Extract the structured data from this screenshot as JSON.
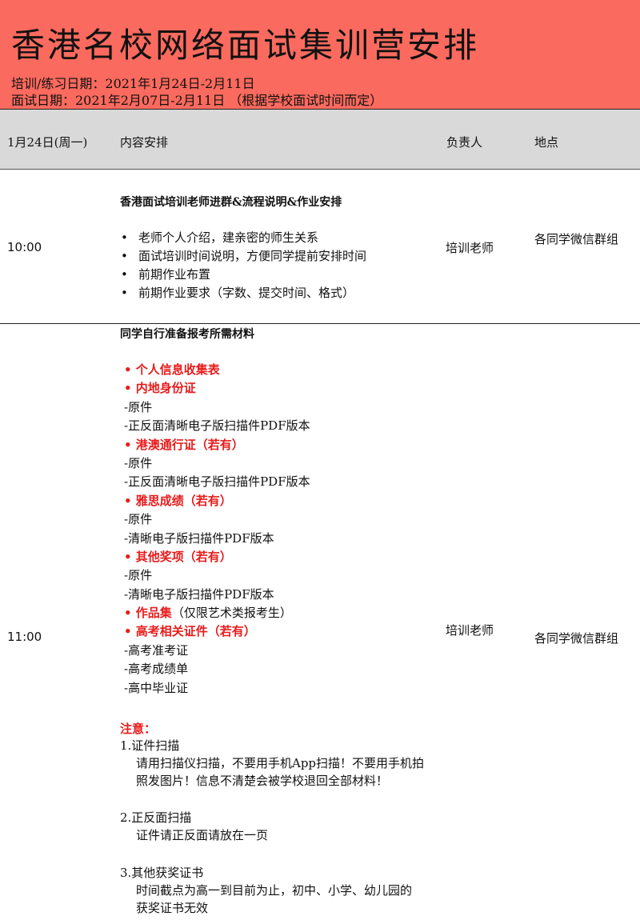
{
  "header": {
    "title": "香港名校网络面试集训营安排",
    "training_dates": "培训/练习日期：2021年1月24日-2月11日",
    "interview_dates": "面试日期：2021年2月07日-2月11日  （根据学校面试时间而定）"
  },
  "columns": {
    "date": "1月24日(周一)",
    "content": "内容安排",
    "owner": "负责人",
    "location": "地点"
  },
  "row1": {
    "time": "10:00",
    "heading": "香港面试培训老师进群&流程说明&作业安排",
    "bullets": [
      "老师个人介绍，建亲密的师生关系",
      "面试培训时间说明，方便同学提前安排时间",
      "前期作业布置",
      "前期作业要求（字数、提交时间、格式）"
    ],
    "owner": "培训老师",
    "location": "各同学微信群组"
  },
  "row2": {
    "time": "11:00",
    "heading": "同学自行准备报考所需材料",
    "owner": "培训老师",
    "location": "各同学微信群组",
    "materials": {
      "m1": "• 个人信息收集表",
      "m2": "• 内地身份证",
      "m2a": "-原件",
      "m2b": "-正反面清晰电子版扫描件PDF版本",
      "m3": "• 港澳通行证（若有）",
      "m3a": "-原件",
      "m3b": "-正反面清晰电子版扫描件PDF版本",
      "m4": "• 雅思成绩（若有）",
      "m4a": "-原件",
      "m4b": "-清晰电子版扫描件PDF版本",
      "m5": "• 其他奖项（若有）",
      "m5a": "-原件",
      "m5b": "-清晰电子版扫描件PDF版本",
      "m6": "• 作品集",
      "m6_note": "（仅限艺术类报考生）",
      "m7": "• 高考相关证件（若有）",
      "m7a": "-高考准考证",
      "m7b": "-高考成绩单",
      "m7c": "-高中毕业证"
    },
    "notes": {
      "title": "注意：",
      "n1_title": "1.证件扫描",
      "n1_body": "请用扫描仪扫描，不要用手机App扫描！不要用手机拍照发图片！信息不清楚会被学校退回全部材料！",
      "n2_title": "2.正反面扫描",
      "n2_body": "证件请正反面请放在一页",
      "n3_title": "3.其他获奖证书",
      "n3_body": "时间截点为高一到目前为止，初中、小学、幼儿园的",
      "n3_body2": "获奖证书无效"
    }
  }
}
